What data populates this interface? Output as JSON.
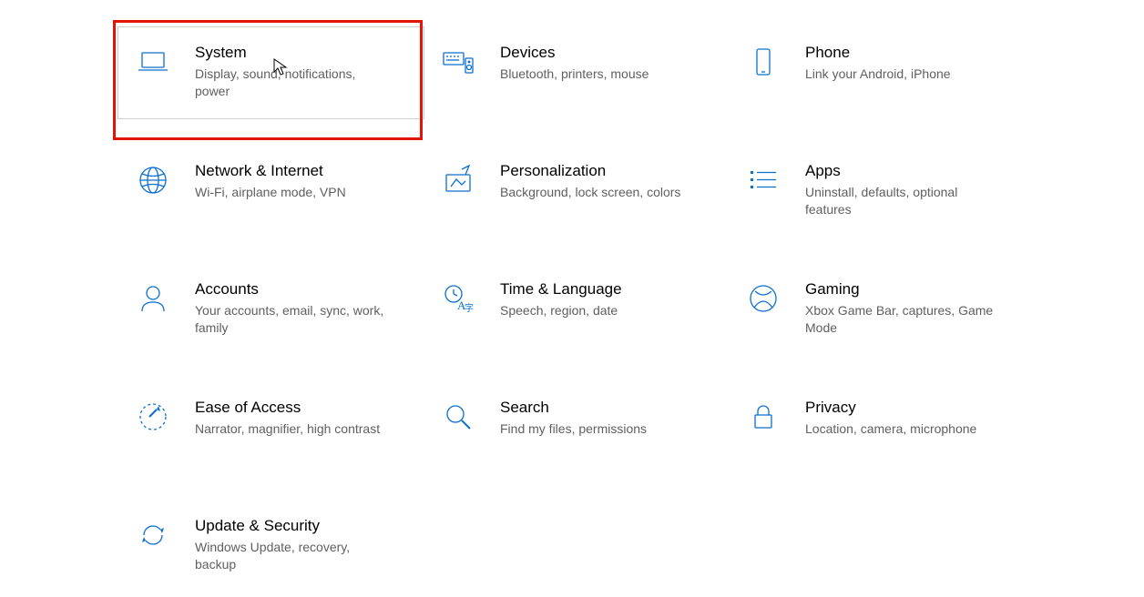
{
  "tiles": [
    {
      "id": "system",
      "title": "System",
      "desc": "Display, sound, notifications, power",
      "selected": true
    },
    {
      "id": "devices",
      "title": "Devices",
      "desc": "Bluetooth, printers, mouse"
    },
    {
      "id": "phone",
      "title": "Phone",
      "desc": "Link your Android, iPhone"
    },
    {
      "id": "network",
      "title": "Network & Internet",
      "desc": "Wi-Fi, airplane mode, VPN"
    },
    {
      "id": "personalization",
      "title": "Personalization",
      "desc": "Background, lock screen, colors"
    },
    {
      "id": "apps",
      "title": "Apps",
      "desc": "Uninstall, defaults, optional features"
    },
    {
      "id": "accounts",
      "title": "Accounts",
      "desc": "Your accounts, email, sync, work, family"
    },
    {
      "id": "time",
      "title": "Time & Language",
      "desc": "Speech, region, date"
    },
    {
      "id": "gaming",
      "title": "Gaming",
      "desc": "Xbox Game Bar, captures, Game Mode"
    },
    {
      "id": "ease",
      "title": "Ease of Access",
      "desc": "Narrator, magnifier, high contrast"
    },
    {
      "id": "search",
      "title": "Search",
      "desc": "Find my files, permissions"
    },
    {
      "id": "privacy",
      "title": "Privacy",
      "desc": "Location, camera, microphone"
    },
    {
      "id": "update",
      "title": "Update & Security",
      "desc": "Windows Update, recovery, backup"
    }
  ]
}
